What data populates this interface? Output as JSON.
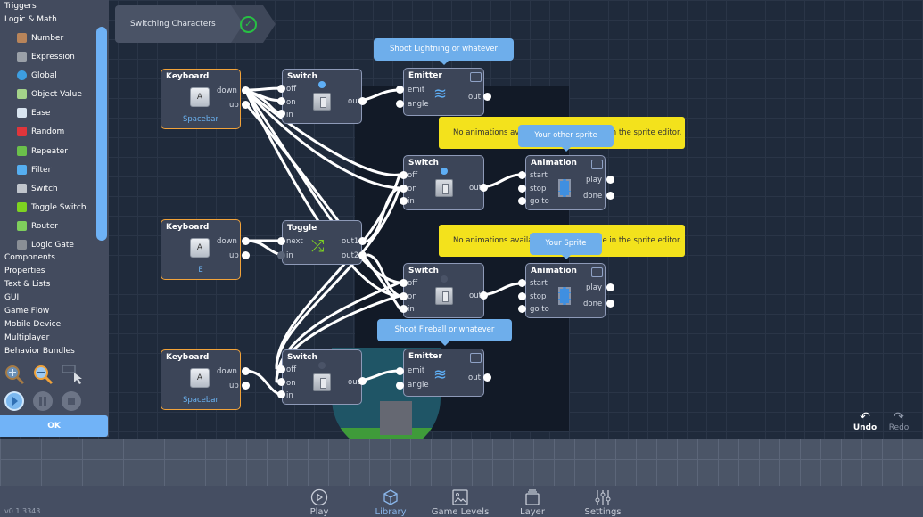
{
  "sidebar": {
    "categories_top": [
      "Triggers",
      "Logic & Math"
    ],
    "items": [
      {
        "label": "Number",
        "icon": "number-icon",
        "color": "#b8845a"
      },
      {
        "label": "Expression",
        "icon": "expression-icon",
        "color": "#9aa0a8"
      },
      {
        "label": "Global",
        "icon": "globe-icon",
        "color": "#3d9ee0"
      },
      {
        "label": "Object Value",
        "icon": "tag-icon",
        "color": "#a4d38a"
      },
      {
        "label": "Ease",
        "icon": "ease-curve-icon",
        "color": "#d8e4f0"
      },
      {
        "label": "Random",
        "icon": "dice-icon",
        "color": "#e0353b"
      },
      {
        "label": "Repeater",
        "icon": "repeat-icon",
        "color": "#6bc04b"
      },
      {
        "label": "Filter",
        "icon": "funnel-icon",
        "color": "#55aef0"
      },
      {
        "label": "Switch",
        "icon": "switch-icon",
        "color": "#c0c5cc"
      },
      {
        "label": "Toggle Switch",
        "icon": "shuffle-icon",
        "color": "#7ed321"
      },
      {
        "label": "Router",
        "icon": "router-icon",
        "color": "#7fcf5c"
      },
      {
        "label": "Logic Gate",
        "icon": "logic-gate-icon",
        "color": "#8a8f96"
      }
    ],
    "categories_bottom": [
      "Components",
      "Properties",
      "Text & Lists",
      "GUI",
      "Game Flow",
      "Mobile Device",
      "Multiplayer",
      "Behavior Bundles"
    ],
    "ok_label": "OK"
  },
  "breadcrumb": {
    "title": "Switching Characters",
    "status": "check-icon"
  },
  "nodes": {
    "kb1": {
      "title": "Keyboard",
      "key": "A",
      "name": "Spacebar",
      "ports": [
        "down",
        "up"
      ]
    },
    "kb2": {
      "title": "Keyboard",
      "key": "A",
      "name": "E",
      "ports": [
        "down",
        "up"
      ]
    },
    "kb3": {
      "title": "Keyboard",
      "key": "A",
      "name": "Spacebar",
      "ports": [
        "down",
        "up"
      ]
    },
    "sw1": {
      "title": "Switch",
      "inputs": [
        "off",
        "on",
        "in"
      ],
      "output": "out",
      "state": "on"
    },
    "tg": {
      "title": "Toggle",
      "inputs": [
        "next",
        "in"
      ],
      "outputs": [
        "out1",
        "out2"
      ]
    },
    "sw3": {
      "title": "Switch",
      "inputs": [
        "off",
        "on",
        "in"
      ],
      "output": "out",
      "state": "off"
    },
    "em1": {
      "title": "Emitter",
      "inputs": [
        "emit",
        "angle"
      ],
      "output": "out",
      "bubble": "Shoot Lightning or whatever"
    },
    "sw2": {
      "title": "Switch",
      "inputs": [
        "off",
        "on",
        "in"
      ],
      "output": "out",
      "state": "on"
    },
    "an1": {
      "title": "Animation",
      "inputs": [
        "start",
        "stop",
        "go to"
      ],
      "outputs": [
        "play",
        "done"
      ],
      "bubble": "Your other sprite",
      "warning": "No animations available, first create one in the sprite editor."
    },
    "sw4": {
      "title": "Switch",
      "inputs": [
        "off",
        "on",
        "in"
      ],
      "output": "out",
      "state": "off"
    },
    "an2": {
      "title": "Animation",
      "inputs": [
        "start",
        "stop",
        "go to"
      ],
      "outputs": [
        "play",
        "done"
      ],
      "bubble": "Your Sprite",
      "warning": "No animations available, first create one in the sprite editor."
    },
    "em2": {
      "title": "Emitter",
      "inputs": [
        "emit",
        "angle"
      ],
      "output": "out",
      "bubble": "Shoot Fireball or whatever"
    }
  },
  "history": {
    "undo": "Undo",
    "redo": "Redo"
  },
  "bottom_nav": [
    {
      "label": "Play",
      "icon": "play-circle-icon"
    },
    {
      "label": "Library",
      "icon": "cube-icon",
      "active": true
    },
    {
      "label": "Game Levels",
      "icon": "image-icon"
    },
    {
      "label": "Layer",
      "icon": "layers-icon"
    },
    {
      "label": "Settings",
      "icon": "sliders-icon"
    }
  ],
  "version": "v0.1.3343"
}
